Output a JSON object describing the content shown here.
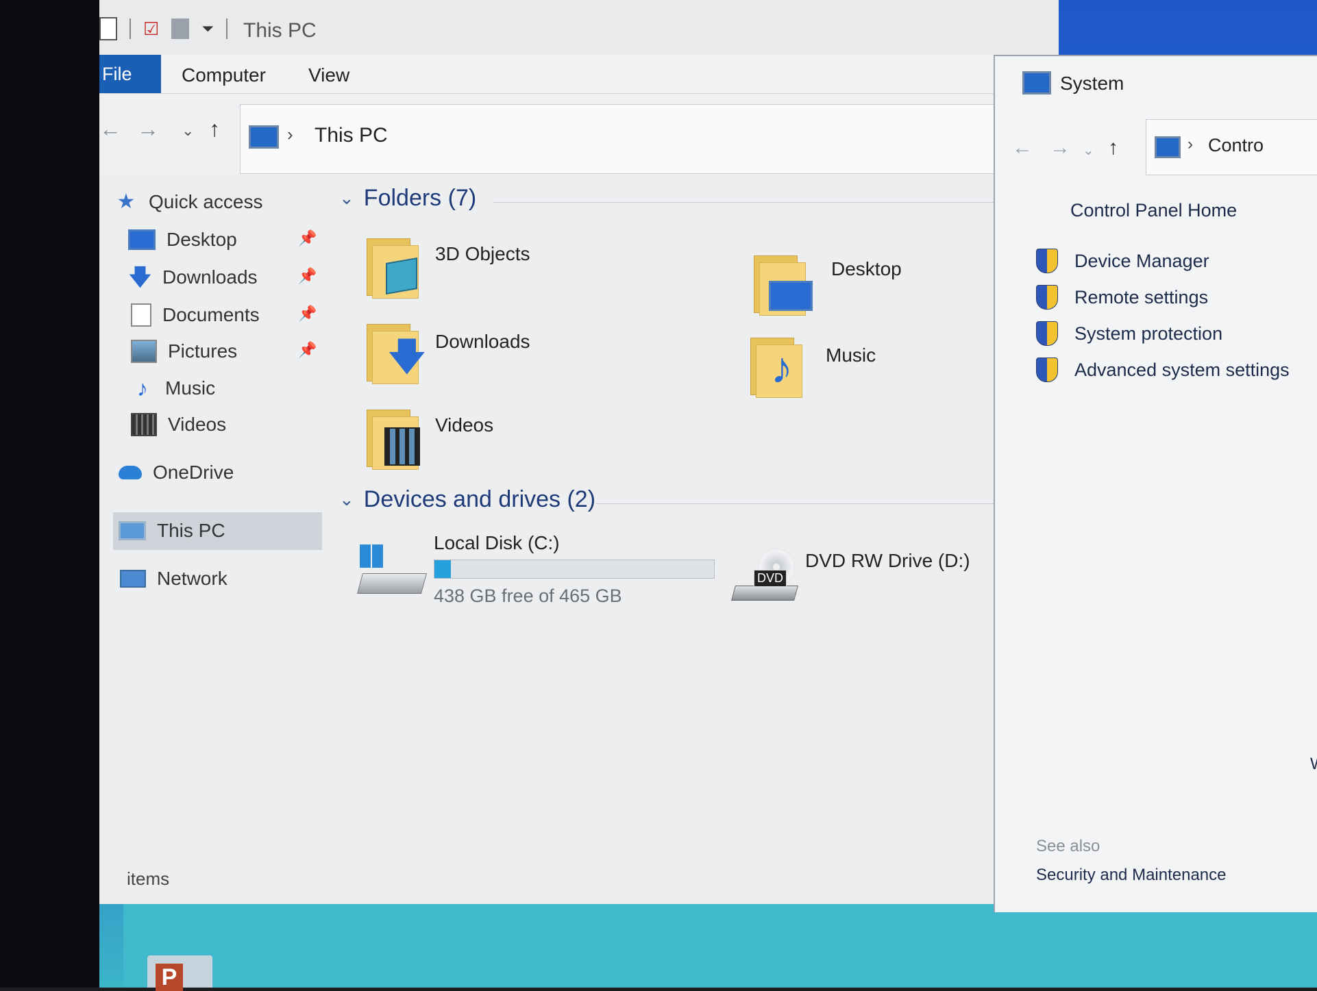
{
  "explorer": {
    "title": "This PC",
    "ribbon_tabs": [
      "File",
      "Computer",
      "View"
    ],
    "address_path": "This PC",
    "nav": {
      "quick_access": "Quick access",
      "items": [
        {
          "label": "Desktop",
          "icon": "desktop-icon",
          "pinned": true
        },
        {
          "label": "Downloads",
          "icon": "downloads-icon",
          "pinned": true
        },
        {
          "label": "Documents",
          "icon": "documents-icon",
          "pinned": true
        },
        {
          "label": "Pictures",
          "icon": "pictures-icon",
          "pinned": true
        },
        {
          "label": "Music",
          "icon": "music-icon",
          "pinned": false
        },
        {
          "label": "Videos",
          "icon": "videos-icon",
          "pinned": false
        }
      ],
      "onedrive": "OneDrive",
      "this_pc": "This PC",
      "network": "Network"
    },
    "folders_header": "Folders (7)",
    "folders": [
      "3D Objects",
      "Desktop",
      "Downloads",
      "Music",
      "Videos"
    ],
    "devices_header": "Devices and drives (2)",
    "drives": {
      "local_disk": {
        "name": "Local Disk (C:)",
        "free_text": "438 GB free of 465 GB",
        "used_fraction": 0.058
      },
      "dvd": {
        "name": "DVD RW Drive (D:)",
        "badge": "DVD"
      }
    },
    "status_items": "items"
  },
  "system": {
    "title": "System",
    "address_text": "Contro",
    "control_panel_home": "Control Panel Home",
    "links": [
      "Device Manager",
      "Remote settings",
      "System protection",
      "Advanced system settings"
    ],
    "see_also": "See also",
    "security_maintenance": "Security and Maintenance",
    "partial_text": "W"
  },
  "taskbar": {
    "app_letter": "P"
  },
  "colors": {
    "accent": "#1a5fb4",
    "progress": "#26a0da",
    "header_text": "#1e3a78"
  }
}
